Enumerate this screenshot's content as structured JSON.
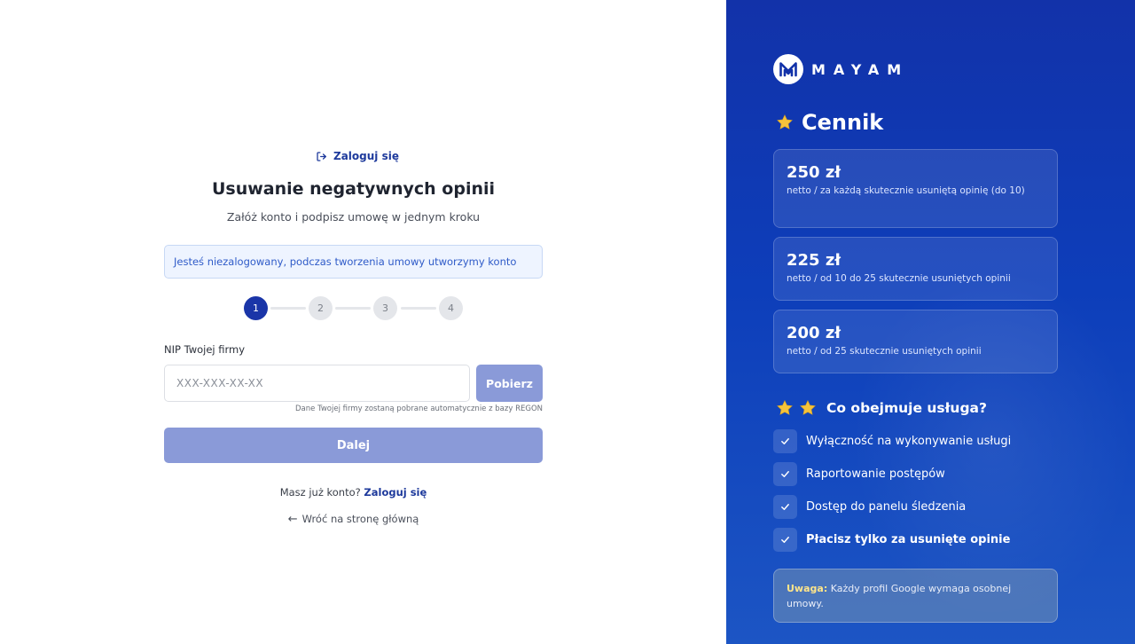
{
  "form": {
    "login_link": "Zaloguj się",
    "title": "Usuwanie negatywnych opinii",
    "subtitle": "Załóż konto i podpisz umowę w jednym kroku",
    "info_message": "Jesteś niezalogowany, podczas tworzenia umowy utworzymy konto",
    "steps": [
      "1",
      "2",
      "3",
      "4"
    ],
    "active_step": 1,
    "nip": {
      "label": "NIP Twojej firmy",
      "placeholder": "XXX-XXX-XX-XX",
      "value": "",
      "fetch_button": "Pobierz",
      "hint": "Dane Twojej firmy zostaną pobrane automatycznie z bazy REGON"
    },
    "next_button": "Dalej",
    "has_account_text": "Masz już konto?",
    "has_account_link": "Zaloguj się",
    "back_link": "Wróć na stronę główną",
    "back_arrow": "←"
  },
  "brand": {
    "name": "MAYAM",
    "logo_icon": "m-logo-icon"
  },
  "pricing": {
    "title": "Cennik",
    "plans": [
      {
        "price": "250 zł",
        "description": "netto / za każdą skutecznie usuniętą opinię (do 10)"
      },
      {
        "price": "225 zł",
        "description": "netto / od 10 do 25 skutecznie usuniętych opinii"
      },
      {
        "price": "200 zł",
        "description": "netto / od 25 skutecznie usuniętych opinii"
      }
    ]
  },
  "includes": {
    "title": "Co obejmuje usługa?",
    "items": [
      {
        "label": "Wyłączność na wykonywanie usługi",
        "bold": false
      },
      {
        "label": "Raportowanie postępów",
        "bold": false
      },
      {
        "label": "Dostęp do panelu śledzenia",
        "bold": false
      },
      {
        "label": "Płacisz tylko za usunięte opinie",
        "bold": true
      }
    ]
  },
  "note": {
    "label": "Uwaga:",
    "text": "Każdy profil Google wymaga osobnej umowy."
  },
  "colors": {
    "accent": "#1a35a8",
    "button_disabled": "#8a9ad8",
    "link": "#1e3a9c",
    "panel_bg": "#0d3eba",
    "star": "#f5c33b",
    "note_label": "#ffe58a"
  }
}
